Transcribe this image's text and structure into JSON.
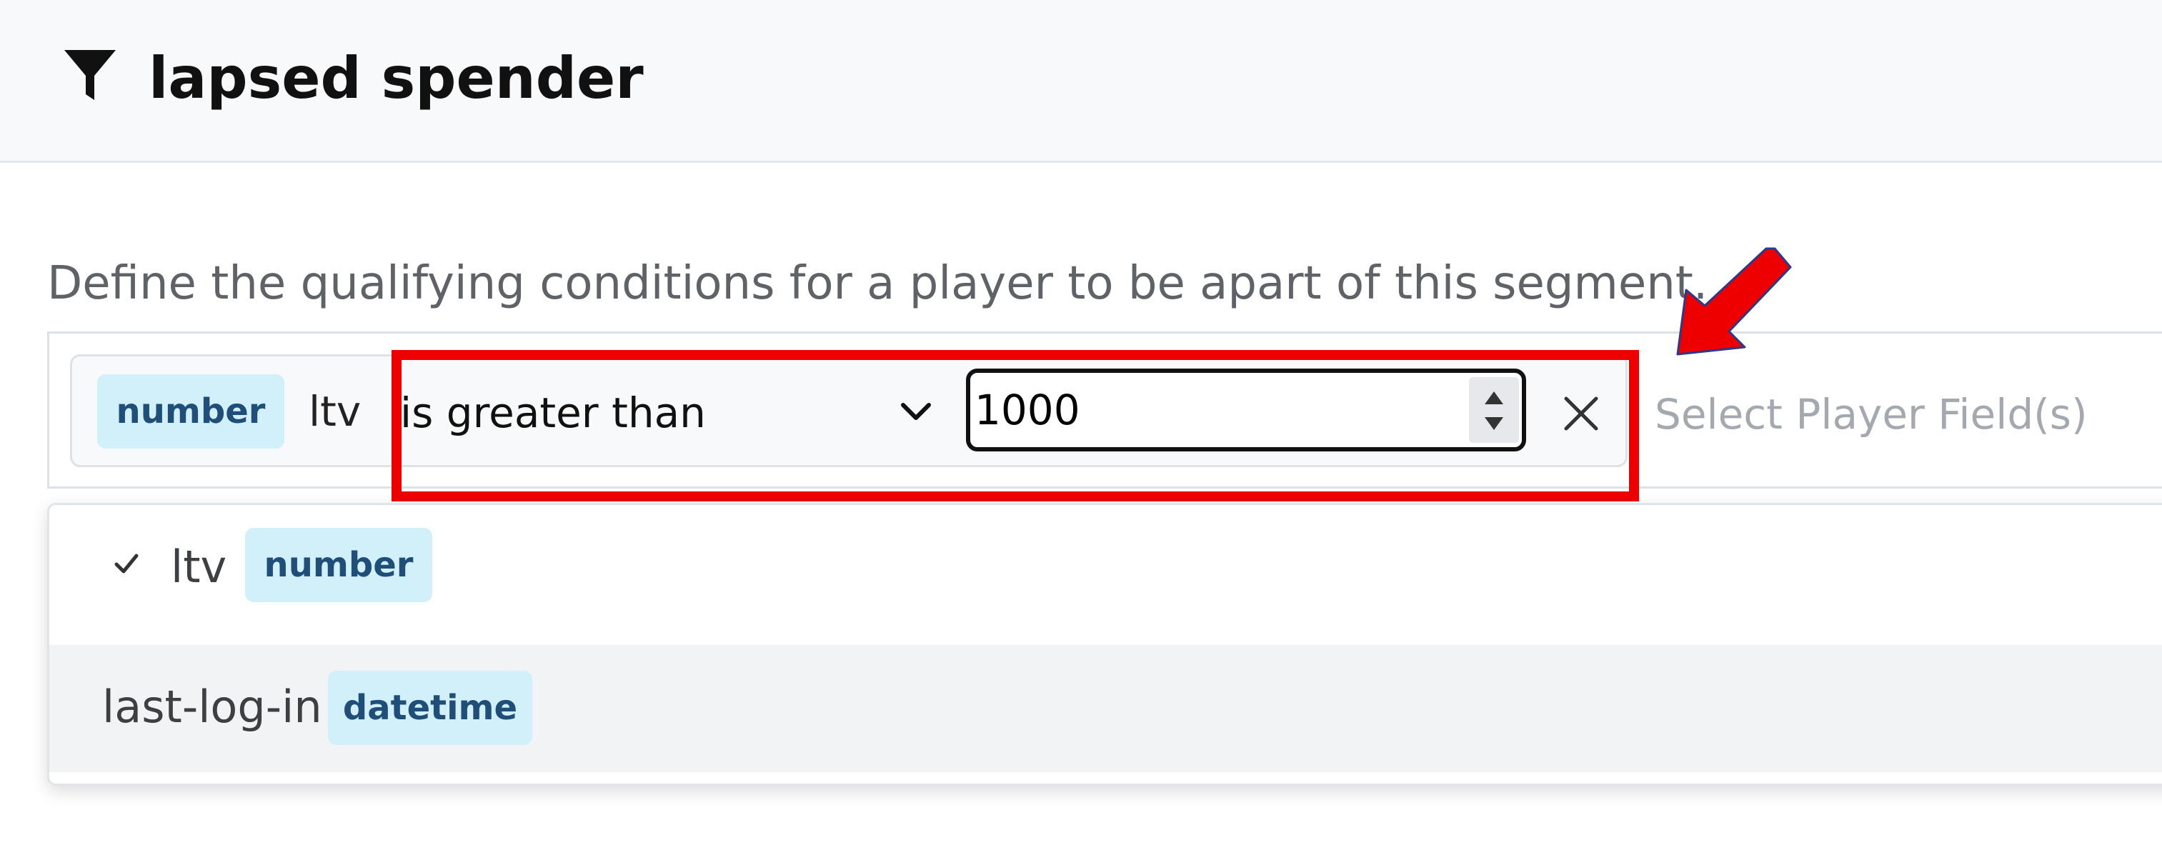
{
  "segment": {
    "title": "lapsed spender",
    "description": "Define the qualifying conditions for a player to be apart of this segment."
  },
  "condition": {
    "field_type": "number",
    "field_name": "ltv",
    "operator": "is greater than",
    "value": "1000"
  },
  "player_field_select": {
    "placeholder": "Select Player Field(s)"
  },
  "field_options": [
    {
      "label": "ltv",
      "type": "number",
      "selected": true
    },
    {
      "label": "last-log-in",
      "type": "datetime",
      "selected": false
    }
  ],
  "icons": {
    "title": "filter-icon",
    "operator_dropdown": "chevron-down-icon",
    "clear": "close-icon",
    "selected": "check-icon",
    "annotation": "red-arrow"
  },
  "colors": {
    "badge_bg": "#d1f0f9",
    "badge_text": "#1f4e79",
    "highlight": "#ee0000",
    "placeholder": "#a4a9b0"
  }
}
